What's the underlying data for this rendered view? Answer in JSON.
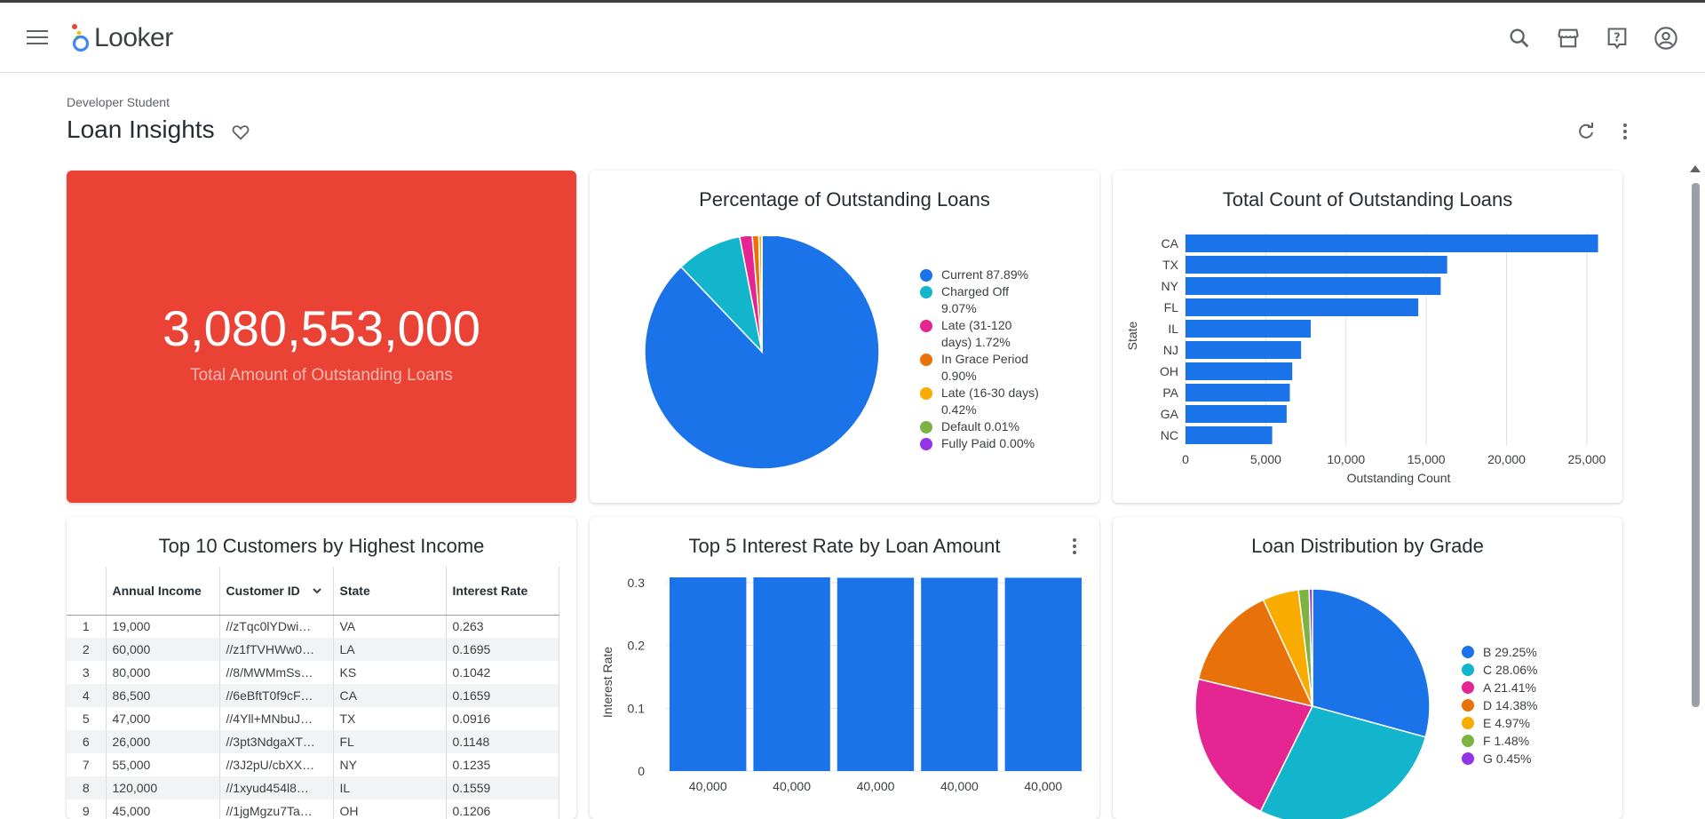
{
  "app": {
    "brand": "Looker"
  },
  "icons": {
    "menu": "hamburger-menu-icon",
    "search": "search-icon",
    "marketplace": "store-icon",
    "help": "help-icon",
    "account": "account-circle-icon",
    "favorite": "heart-outline-icon",
    "refresh": "refresh-icon",
    "more": "more-vert-icon"
  },
  "header": {
    "breadcrumb": "Developer Student",
    "title": "Loan Insights"
  },
  "colors": {
    "kpi_bg": "#ea4335",
    "blue": "#1a73e8",
    "teal": "#12b5cb",
    "pink": "#e52592",
    "orange": "#e8710a",
    "yellow": "#f9ab00",
    "green": "#7cb342",
    "purple": "#9334e6"
  },
  "tiles": {
    "kpi": {
      "value": "3,080,553,000",
      "label": "Total Amount of Outstanding Loans"
    },
    "status_pie": {
      "title": "Percentage of Outstanding Loans",
      "legend": [
        {
          "line1": "Current 87.89%",
          "line2": ""
        },
        {
          "line1": "Charged Off",
          "line2": "9.07%"
        },
        {
          "line1": "Late (31-120",
          "line2": "days) 1.72%"
        },
        {
          "line1": "In Grace Period",
          "line2": "0.90%"
        },
        {
          "line1": "Late (16-30 days)",
          "line2": "0.42%"
        },
        {
          "line1": "Default 0.01%",
          "line2": ""
        },
        {
          "line1": "Fully Paid 0.00%",
          "line2": ""
        }
      ]
    },
    "state_bar": {
      "title": "Total Count of Outstanding Loans",
      "y_label": "State",
      "x_label": "Outstanding Count"
    },
    "customers": {
      "title": "Top 10 Customers by Highest Income",
      "columns": [
        "Annual Income",
        "Customer ID",
        "State",
        "Interest Rate"
      ],
      "rows": [
        {
          "n": "1",
          "income": "19,000",
          "id": "//zTqc0lYDwi…",
          "state": "VA",
          "rate": "0.263"
        },
        {
          "n": "2",
          "income": "60,000",
          "id": "//z1fTVHWw0…",
          "state": "LA",
          "rate": "0.1695"
        },
        {
          "n": "3",
          "income": "80,000",
          "id": "//8/MWMmSs…",
          "state": "KS",
          "rate": "0.1042"
        },
        {
          "n": "4",
          "income": "86,500",
          "id": "//6eBftT0f9cF…",
          "state": "CA",
          "rate": "0.1659"
        },
        {
          "n": "5",
          "income": "47,000",
          "id": "//4Yll+MNbuJ…",
          "state": "TX",
          "rate": "0.0916"
        },
        {
          "n": "6",
          "income": "26,000",
          "id": "//3pt3NdgaXT…",
          "state": "FL",
          "rate": "0.1148"
        },
        {
          "n": "7",
          "income": "55,000",
          "id": "//3J2pU/cbXX…",
          "state": "NY",
          "rate": "0.1235"
        },
        {
          "n": "8",
          "income": "120,000",
          "id": "//1xyud454l8…",
          "state": "IL",
          "rate": "0.1559"
        },
        {
          "n": "9",
          "income": "45,000",
          "id": "//1jgMgzu7Ta…",
          "state": "OH",
          "rate": "0.1206"
        }
      ]
    },
    "interest_bar": {
      "title": "Top 5 Interest Rate by Loan Amount",
      "y_label": "Interest Rate"
    },
    "grade_pie": {
      "title": "Loan Distribution by Grade",
      "legend": [
        "B 29.25%",
        "C 28.06%",
        "A 21.41%",
        "D 14.38%",
        "E 4.97%",
        "F 1.48%",
        "G 0.45%"
      ]
    }
  },
  "chart_data": [
    {
      "type": "pie",
      "title": "Percentage of Outstanding Loans",
      "categories": [
        "Current",
        "Charged Off",
        "Late (31-120 days)",
        "In Grace Period",
        "Late (16-30 days)",
        "Default",
        "Fully Paid"
      ],
      "values": [
        87.89,
        9.07,
        1.72,
        0.9,
        0.42,
        0.01,
        0.0
      ],
      "colors": [
        "#1a73e8",
        "#12b5cb",
        "#e52592",
        "#e8710a",
        "#f9ab00",
        "#7cb342",
        "#9334e6"
      ],
      "legend": "right"
    },
    {
      "type": "bar",
      "orientation": "horizontal",
      "title": "Total Count of Outstanding Loans",
      "categories": [
        "CA",
        "TX",
        "NY",
        "FL",
        "IL",
        "NJ",
        "OH",
        "PA",
        "GA",
        "NC"
      ],
      "values": [
        25700,
        16300,
        15900,
        14500,
        7800,
        7200,
        6650,
        6500,
        6300,
        5400
      ],
      "xlabel": "Outstanding Count",
      "ylabel": "State",
      "xlim": [
        0,
        26000
      ],
      "xticks": [
        "0",
        "5,000",
        "10,000",
        "15,000",
        "20,000",
        "25,000"
      ],
      "xtick_values": [
        0,
        5000,
        10000,
        15000,
        20000,
        25000
      ],
      "grid": true
    },
    {
      "type": "bar",
      "title": "Top 5 Interest Rate by Loan Amount",
      "categories": [
        "40,000",
        "40,000",
        "40,000",
        "40,000",
        "40,000"
      ],
      "values": [
        0.3097,
        0.3094,
        0.3079,
        0.3079,
        0.3079
      ],
      "ylabel": "Interest Rate",
      "ylim": [
        0,
        0.3
      ],
      "yticks": [
        "0",
        "0.1",
        "0.2",
        "0.3"
      ],
      "ytick_values": [
        0,
        0.1,
        0.2,
        0.3
      ],
      "grid": true
    },
    {
      "type": "pie",
      "title": "Loan Distribution by Grade",
      "categories": [
        "B",
        "C",
        "A",
        "D",
        "E",
        "F",
        "G"
      ],
      "values": [
        29.25,
        28.06,
        21.41,
        14.38,
        4.97,
        1.48,
        0.45
      ],
      "colors": [
        "#1a73e8",
        "#12b5cb",
        "#e52592",
        "#e8710a",
        "#f9ab00",
        "#7cb342",
        "#9334e6"
      ],
      "legend": "right"
    }
  ]
}
